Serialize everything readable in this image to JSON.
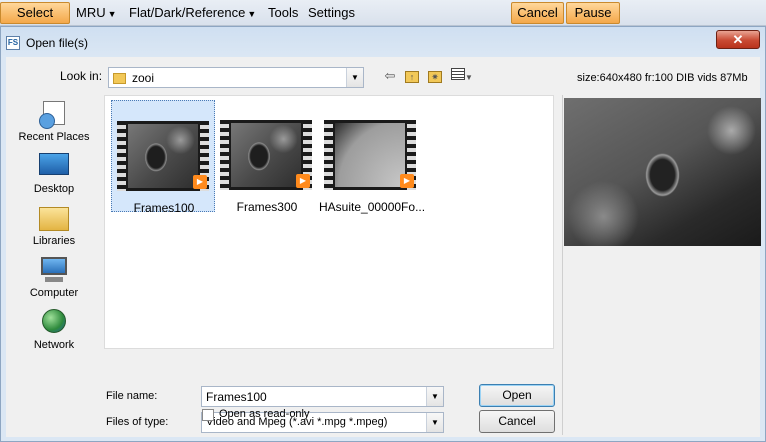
{
  "toolbar": {
    "select_label": "Select",
    "mru_label": "MRU",
    "flat_label": "Flat/Dark/Reference",
    "tools_label": "Tools",
    "settings_label": "Settings",
    "cancel_label": "Cancel",
    "pause_label": "Pause"
  },
  "dialog": {
    "title": "Open file(s)",
    "close_glyph": "✕",
    "look_in_label": "Look in:",
    "look_in_value": "zooi",
    "size_info": "size:640x480 fr:100 DIB vids 87Mb"
  },
  "places": [
    {
      "label": "Recent Places",
      "icon": "recent-places-icon"
    },
    {
      "label": "Desktop",
      "icon": "desktop-icon"
    },
    {
      "label": "Libraries",
      "icon": "libraries-icon"
    },
    {
      "label": "Computer",
      "icon": "computer-icon"
    },
    {
      "label": "Network",
      "icon": "network-icon"
    }
  ],
  "files": [
    {
      "name": "Frames100",
      "selected": true
    },
    {
      "name": "Frames300",
      "selected": false
    },
    {
      "name": "HAsuite_00000Fo...",
      "selected": false
    }
  ],
  "form": {
    "file_name_label": "File name:",
    "file_name_value": "Frames100",
    "file_type_label": "Files of type:",
    "file_type_value": "Video and Mpeg (*.avi *.mpg *.mpeg)",
    "readonly_label": "Open as read-only",
    "open_label": "Open",
    "cancel_label": "Cancel"
  }
}
